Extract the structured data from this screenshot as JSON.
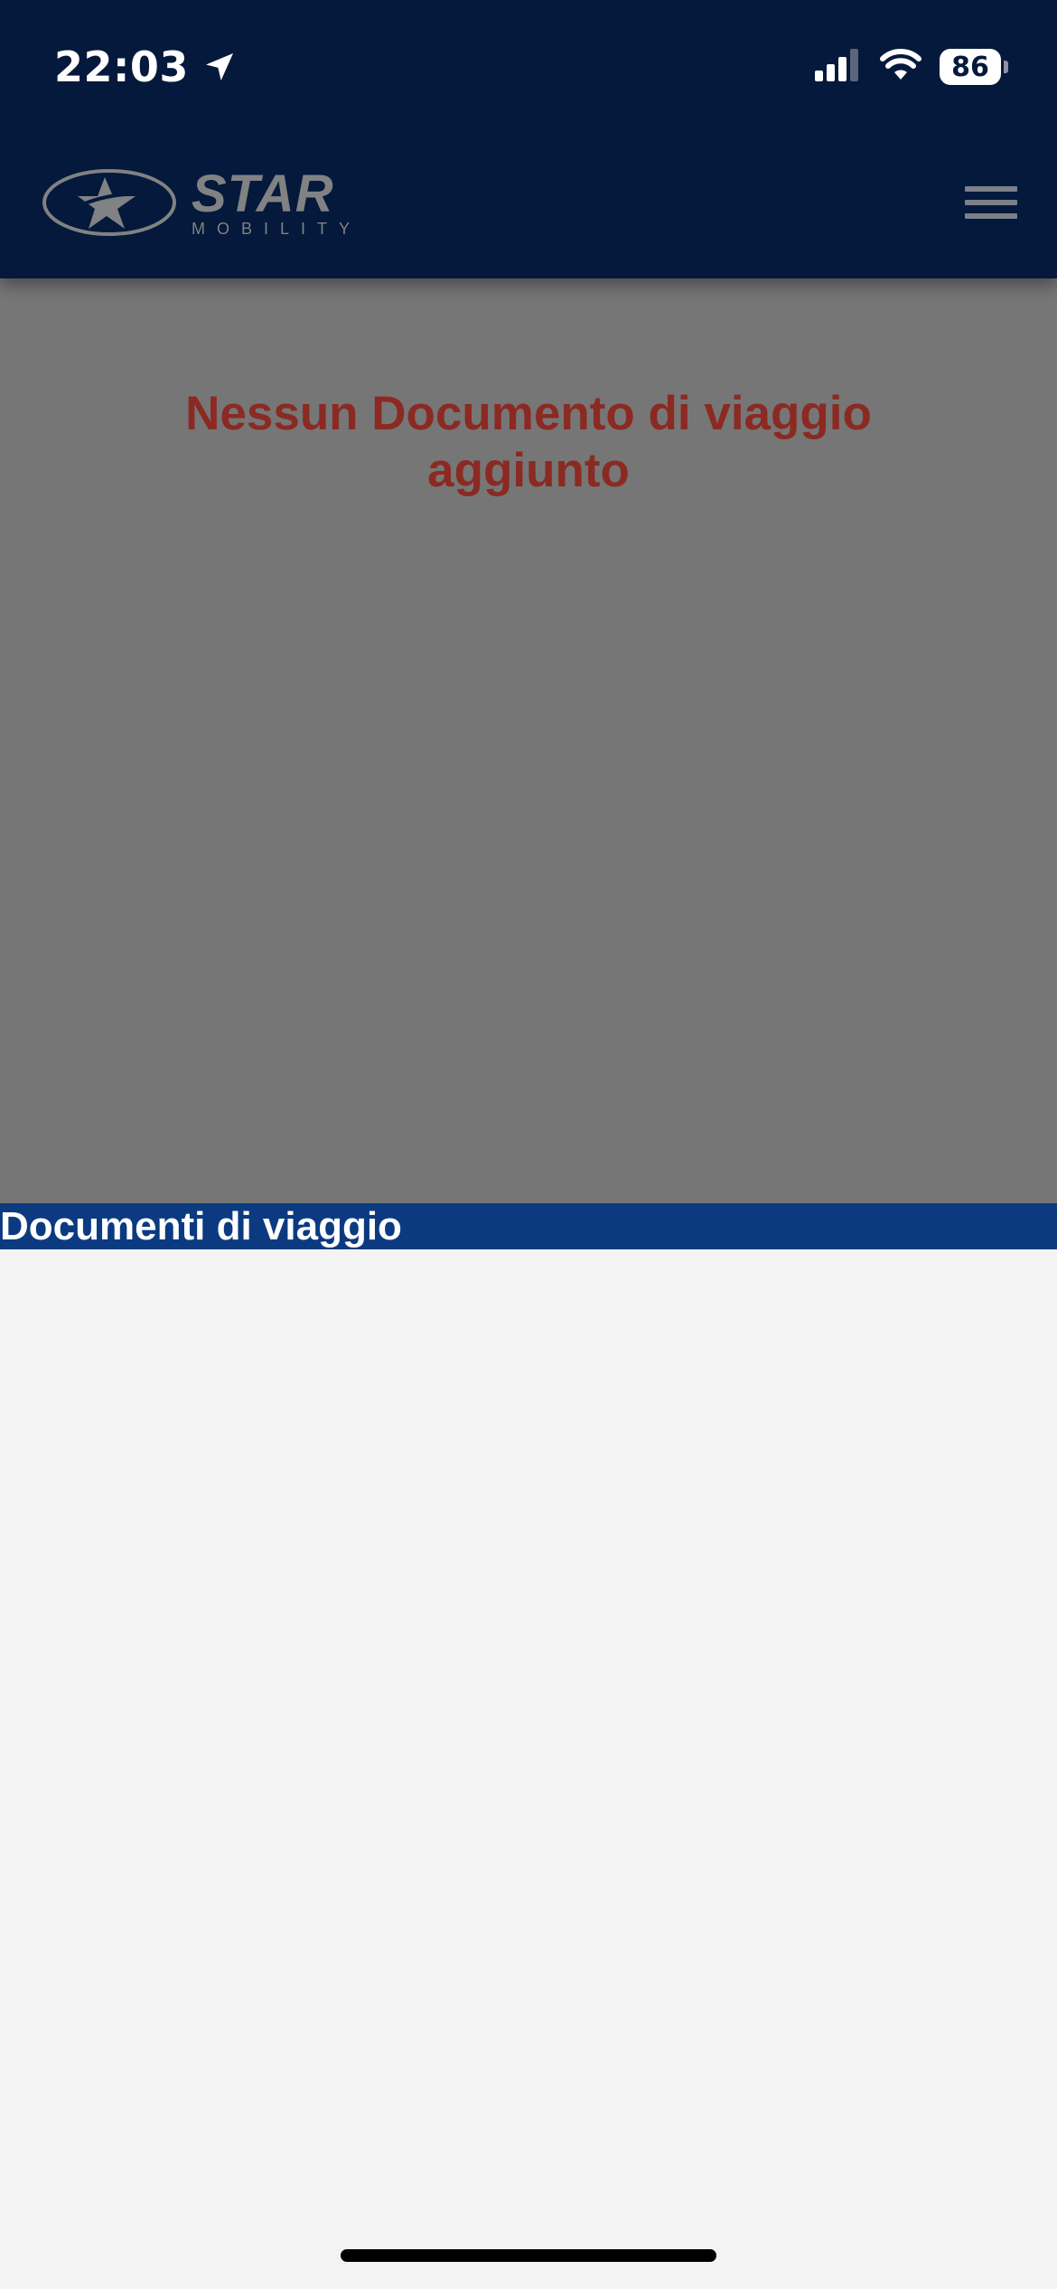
{
  "status_bar": {
    "time": "22:03",
    "battery_level": "86",
    "icons": [
      "location-arrow-icon",
      "cellular-signal-icon",
      "wifi-icon",
      "battery-icon"
    ]
  },
  "app_bar": {
    "logo": {
      "wordmark": "STAR",
      "tagline": "MOBILITY"
    },
    "menu_icon": "hamburger-menu-icon"
  },
  "empty_state": {
    "message": "Nessun Documento di viaggio aggiunto"
  },
  "section": {
    "title": "Documenti di viaggio"
  },
  "colors": {
    "header_bg": "#04193b",
    "overlay_bg": "#767676",
    "empty_message": "#8b2a22",
    "section_bar": "#0b3a80",
    "page_bg": "#f3f3f3"
  }
}
